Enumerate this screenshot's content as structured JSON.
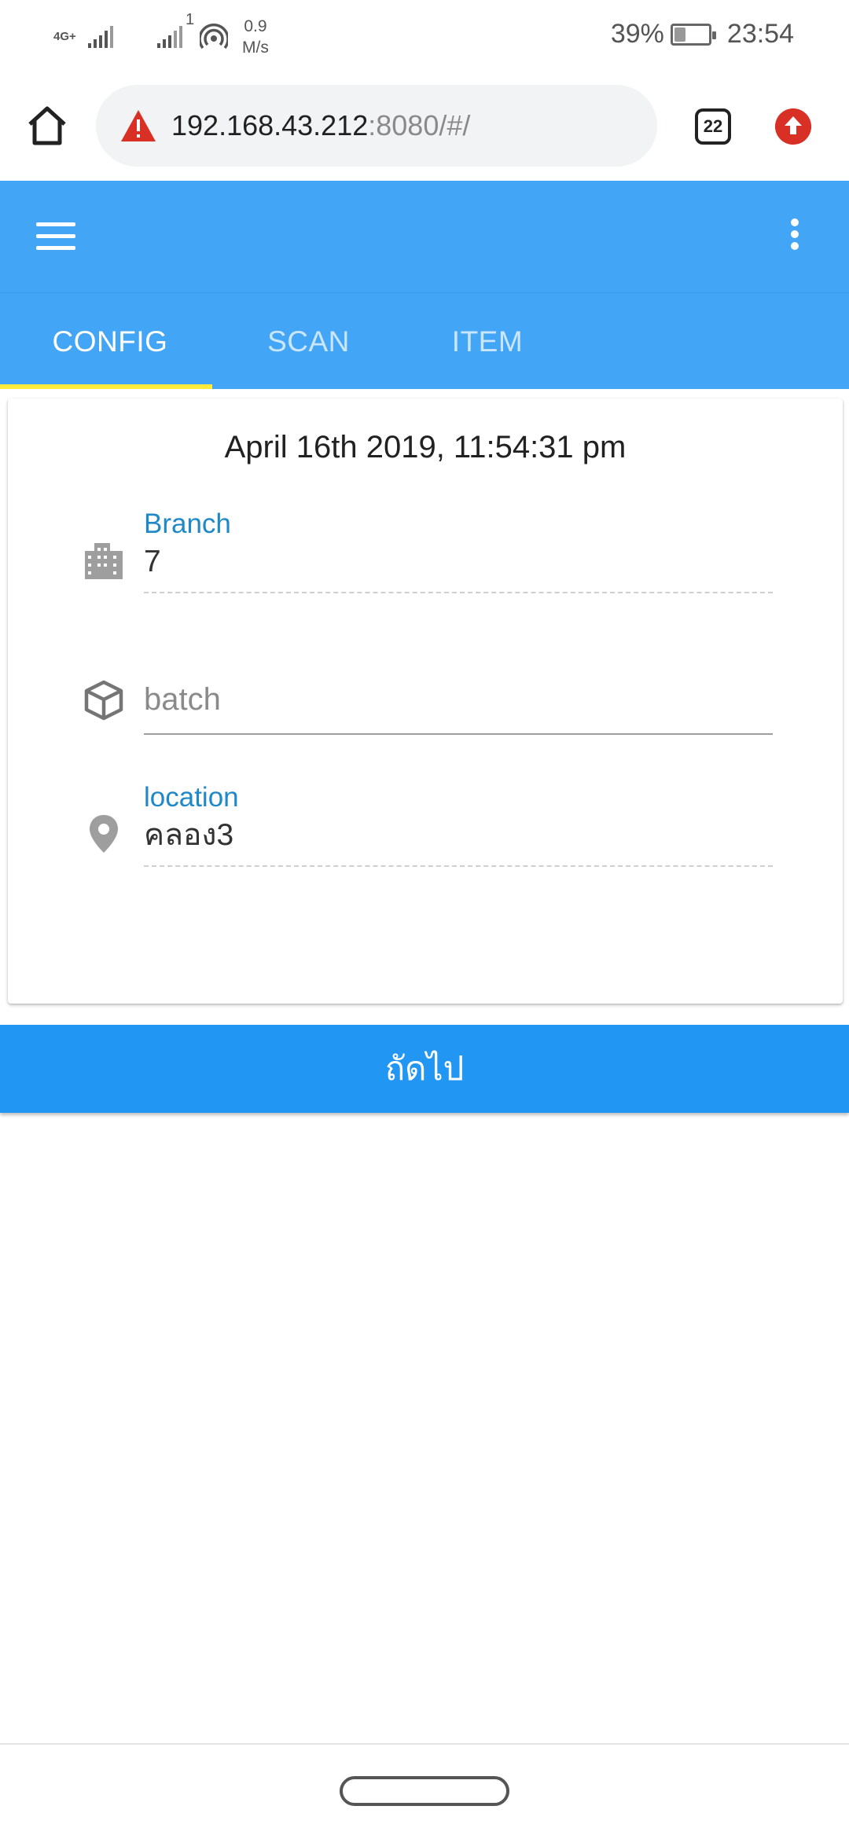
{
  "status_bar": {
    "network_type": "4G+",
    "speed_superscript": "1",
    "speed_value": "0.9",
    "speed_unit": "M/s",
    "battery_percent": "39%",
    "battery_level": 0.39,
    "time": "23:54",
    "icons": [
      "signal-icon",
      "signal-icon",
      "hotspot-icon",
      "battery-icon"
    ]
  },
  "browser": {
    "url_host": "192.168.43.212",
    "url_path": ":8080/#/",
    "tab_count": "22",
    "icons": [
      "home-icon",
      "warning-icon",
      "tabs-icon",
      "upload-icon"
    ],
    "colors": {
      "warning": "#d93025",
      "upload": "#d93025"
    }
  },
  "toolbar": {
    "icons": [
      "menu-icon",
      "more-vert-icon"
    ],
    "color": "#42a5f5"
  },
  "tabs": [
    {
      "label": "CONFIG",
      "active": true
    },
    {
      "label": "SCAN",
      "active": false
    },
    {
      "label": "ITEM",
      "active": false
    }
  ],
  "card": {
    "datetime": "April 16th 2019, 11:54:31 pm",
    "branch": {
      "label": "Branch",
      "value": "7",
      "icon": "building-icon"
    },
    "batch": {
      "placeholder": "batch",
      "value": "",
      "icon": "box-icon"
    },
    "location": {
      "label": "location",
      "value": "คลอง3",
      "icon": "location-pin-icon"
    }
  },
  "next_button": {
    "label": "ถัดไป",
    "color": "#2196f3"
  },
  "colors": {
    "accent": "#42a5f5",
    "tab_indicator": "#ffeb3b",
    "label": "#1e88c8"
  }
}
